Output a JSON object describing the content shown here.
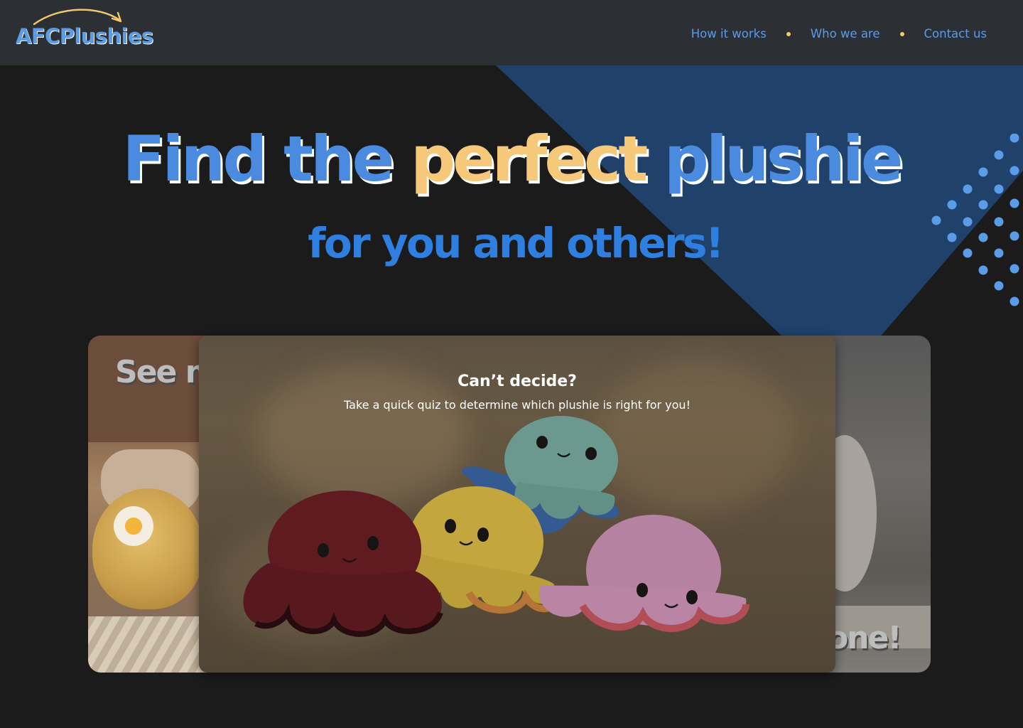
{
  "header": {
    "logo": "AFCPlushies",
    "nav": [
      {
        "label": "How it works"
      },
      {
        "label": "Who we are"
      },
      {
        "label": "Contact us"
      }
    ]
  },
  "hero": {
    "headline_part1": "Find the ",
    "headline_accent": "perfect",
    "headline_part2": " plushie",
    "subheadline": "for you and others!"
  },
  "carousel": {
    "active_card": {
      "title": "Can’t decide?",
      "subtitle": "Take a quick quiz to determine which plushie is right for you!"
    },
    "back_card_left_text": "See m",
    "back_card_right_text": "one!"
  },
  "colors": {
    "primary_blue": "#4a8be0",
    "accent_yellow": "#f6c97a",
    "header_bg": "#2c3035",
    "page_bg": "#1b1b1c",
    "triangle_blue": "#1f416a"
  }
}
